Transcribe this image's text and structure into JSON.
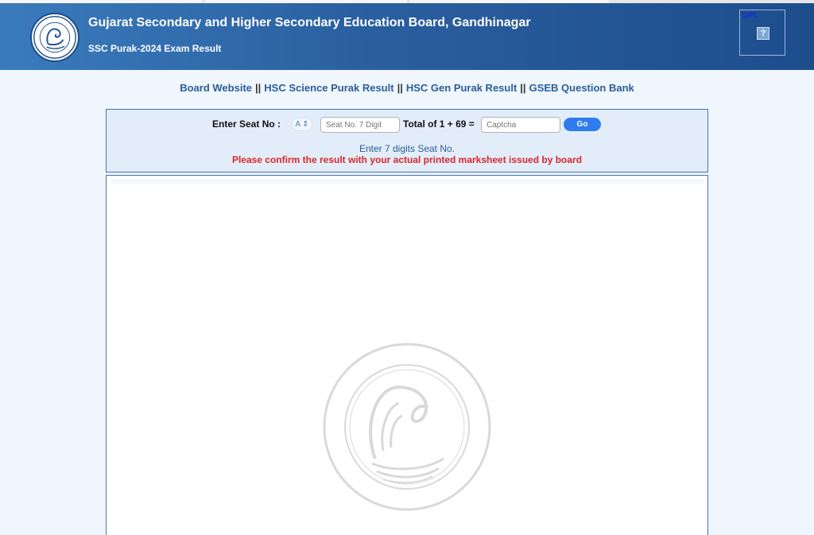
{
  "header": {
    "title": "Gujarat Secondary and Higher Secondary Education Board, Gandhinagar",
    "subtitle": "SSC Purak-2024 Exam Result",
    "logo_icon": "gseb-swan-logo-icon",
    "gipl_label": "GIPL",
    "help_glyph": "?"
  },
  "nav": {
    "links": [
      "Board Website",
      "HSC Science Purak Result",
      "HSC Gen Purak Result",
      "GSEB Question Bank"
    ],
    "separator": "||"
  },
  "search": {
    "seat_label": "Enter Seat No :",
    "seat_prefix_value": "A",
    "seat_placeholder": "Seat No. 7 Digit",
    "captcha_question": "Total of 1 + 69 =",
    "captcha_placeholder": "Captcha",
    "go_label": "Go",
    "hint": "Enter 7 digits Seat No.",
    "warning": "Please confirm the result with your actual printed marksheet issued by board"
  },
  "result": {
    "watermark_icon": "gseb-seal-watermark-icon"
  },
  "colors": {
    "header_gradient_start": "#3a7bbd",
    "header_gradient_end": "#1d4d8c",
    "link": "#2a5d9a",
    "warning": "#d9262a",
    "go_button": "#2e7cf0",
    "panel_bg": "#e3edf9",
    "page_bg": "#f0f6fd"
  }
}
